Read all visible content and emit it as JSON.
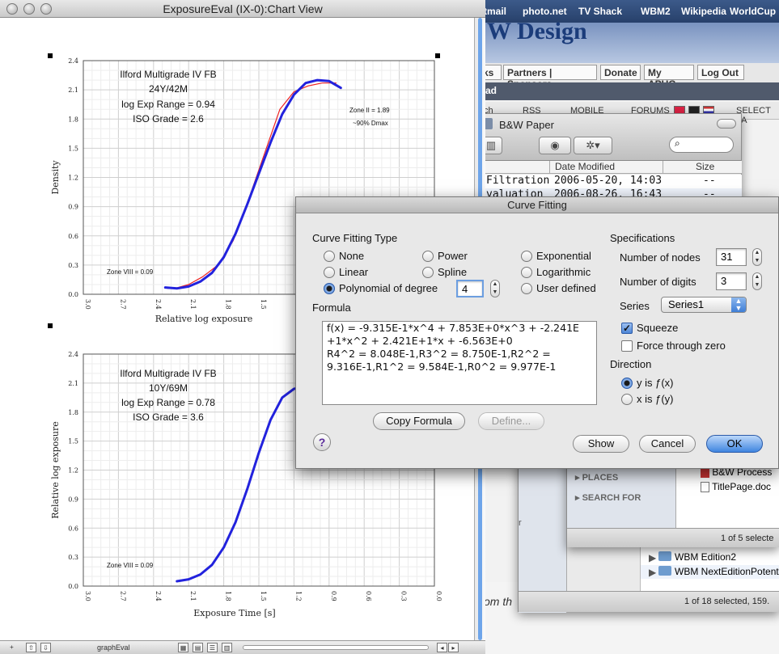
{
  "browser": {
    "bookmarks": [
      "tmail",
      "photo.net",
      "TV Shack",
      "WBM2",
      "Wikipedia",
      "WorldCup"
    ],
    "header_text": "W Design",
    "nav": [
      "ks",
      "Partners | Sponsors",
      "Donate",
      "My APUG",
      "Log Out"
    ],
    "sub_nav": "ad",
    "toolbar": [
      "ch",
      "RSS",
      "MOBILE",
      "FORUMS",
      "SELECT LA"
    ],
    "body_text": "om th"
  },
  "finder_bw": {
    "title": "B&W Paper",
    "search_placeholder": "",
    "columns": [
      "Date Modified",
      "Size"
    ],
    "rows": [
      {
        "name": "Filtration",
        "date": "2006-05-20, 14:03",
        "size": "--"
      },
      {
        "name": "valuation",
        "date": "2006-08-26, 16:43",
        "size": "--"
      }
    ]
  },
  "finder_back": {
    "sidebar": [
      "PLACES",
      "SEARCH FOR"
    ],
    "files": [
      "B&W Process",
      "TitlePage.doc"
    ],
    "status": "1 of 5 selecte",
    "folders": [
      "WBM Edition2",
      "WBM NextEditionPotent"
    ],
    "status2": "1 of 18 selected, 159.",
    "side_letter": "r"
  },
  "chart_window": {
    "title": "ExposureEval (IX-0):Chart View",
    "bottom_label": "graphEval"
  },
  "chart_data": [
    {
      "type": "line",
      "title": "Ilford Multigrade IV FB",
      "annotations": [
        "24Y/42M",
        "log Exp Range = 0.94",
        "ISO Grade = 2.6",
        "Zone II = 1.89",
        "~90% Dmax",
        "Zone VIII = 0.09"
      ],
      "xlabel": "Relative log exposure",
      "ylabel": "Density",
      "x_ticks": [
        "3.0",
        "2.7",
        "2.4",
        "2.1",
        "1.8",
        "1.5",
        "1.2"
      ],
      "y_ticks": [
        "0.0",
        "0.3",
        "0.6",
        "0.9",
        "1.2",
        "1.5",
        "1.8",
        "2.1",
        "2.4"
      ],
      "xlim": [
        3.0,
        0.0
      ],
      "ylim": [
        0.0,
        2.4
      ],
      "series": [
        {
          "color": "#ee2222",
          "x": [
            2.28,
            2.22,
            2.1,
            1.98,
            1.85,
            1.72,
            1.58,
            1.45,
            1.32,
            1.2,
            1.08,
            0.96,
            0.84
          ],
          "y": [
            0.06,
            0.06,
            0.1,
            0.18,
            0.3,
            0.55,
            1.0,
            1.45,
            1.9,
            2.08,
            2.14,
            2.17,
            2.17
          ]
        },
        {
          "color": "#2222dd",
          "x": [
            2.3,
            2.2,
            2.1,
            2.0,
            1.9,
            1.8,
            1.7,
            1.6,
            1.5,
            1.4,
            1.3,
            1.2,
            1.1,
            1.0,
            0.9,
            0.8
          ],
          "y": [
            0.07,
            0.06,
            0.08,
            0.13,
            0.22,
            0.38,
            0.62,
            0.92,
            1.24,
            1.56,
            1.85,
            2.05,
            2.17,
            2.2,
            2.19,
            2.12
          ]
        }
      ]
    },
    {
      "type": "line",
      "title": "Ilford Multigrade IV FB",
      "annotations": [
        "10Y/69M",
        "log Exp Range = 0.78",
        "ISO Grade = 3.6",
        "Zone VIII = 0.09"
      ],
      "xlabel": "Exposure Time [s]",
      "ylabel": "Relative log exposure",
      "x_ticks": [
        "3.0",
        "2.7",
        "2.4",
        "2.1",
        "1.8",
        "1.5",
        "1.2",
        "0.9",
        "0.6",
        "0.3",
        "0.0"
      ],
      "y_ticks": [
        "0.0",
        "0.3",
        "0.6",
        "0.9",
        "1.2",
        "1.5",
        "1.8",
        "2.1",
        "2.4"
      ],
      "xlim": [
        3.0,
        0.0
      ],
      "ylim": [
        0.0,
        2.4
      ],
      "series": [
        {
          "color": "#2222dd",
          "x": [
            2.2,
            2.1,
            2.0,
            1.9,
            1.8,
            1.7,
            1.6,
            1.5,
            1.4,
            1.3,
            1.2,
            1.1
          ],
          "y": [
            0.05,
            0.07,
            0.12,
            0.22,
            0.4,
            0.66,
            1.0,
            1.38,
            1.72,
            1.95,
            2.04,
            2.06
          ]
        }
      ]
    }
  ],
  "dialog": {
    "title": "Curve Fitting",
    "type_heading": "Curve Fitting Type",
    "options": [
      "None",
      "Power",
      "Exponential",
      "Linear",
      "Spline",
      "Logarithmic",
      "Polynomial of degree",
      "User defined"
    ],
    "selected": "Polynomial of degree",
    "degree": "4",
    "formula_heading": "Formula",
    "formula": "f(x) = -9.315E-1*x^4 + 7.853E+0*x^3 + -2.241E\n+1*x^2 + 2.421E+1*x + -6.563E+0\nR4^2 = 8.048E-1,R3^2 = 8.750E-1,R2^2 =\n9.316E-1,R1^2 = 9.584E-1,R0^2 = 9.977E-1",
    "specs_heading": "Specifications",
    "nodes_label": "Number of nodes",
    "nodes": "31",
    "digits_label": "Number of digits",
    "digits": "3",
    "series_label": "Series",
    "series_value": "Series1",
    "squeeze": "Squeeze",
    "force_zero": "Force through zero",
    "direction_heading": "Direction",
    "dir_y": "y is ƒ(x)",
    "dir_x": "x is ƒ(y)",
    "copy_button": "Copy Formula",
    "define_button": "Define...",
    "help": "?",
    "show_button": "Show",
    "cancel_button": "Cancel",
    "ok_button": "OK"
  }
}
